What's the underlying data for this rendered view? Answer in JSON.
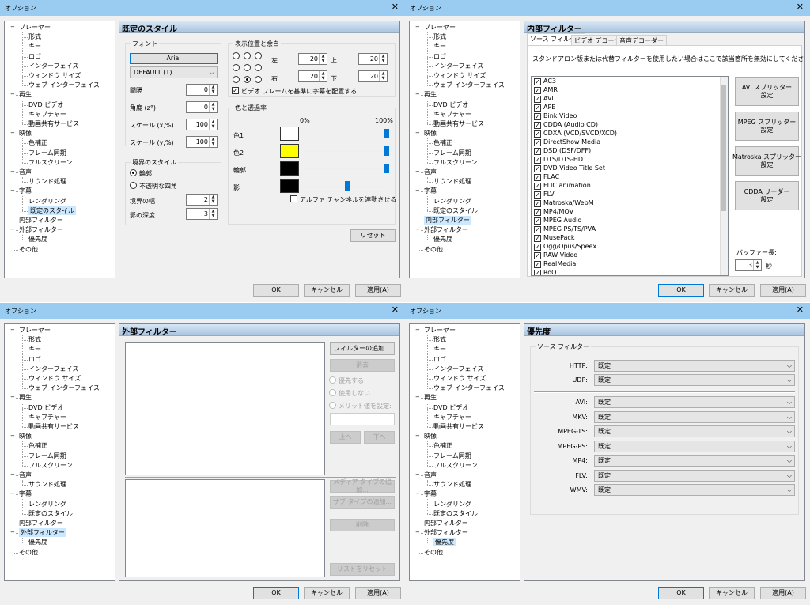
{
  "title": "オプション",
  "close": "✕",
  "tree": [
    {
      "label": "プレーヤー",
      "lv": 0,
      "tog": "−"
    },
    {
      "label": "形式",
      "lv": 1
    },
    {
      "label": "キー",
      "lv": 1
    },
    {
      "label": "ロゴ",
      "lv": 1
    },
    {
      "label": "インターフェイス",
      "lv": 1
    },
    {
      "label": "ウィンドウ サイズ",
      "lv": 1
    },
    {
      "label": "ウェブ インターフェイス",
      "lv": 1
    },
    {
      "label": "再生",
      "lv": 0,
      "tog": "−"
    },
    {
      "label": "DVD ビデオ",
      "lv": 1
    },
    {
      "label": "キャプチャー",
      "lv": 1
    },
    {
      "label": "動画共有サービス",
      "lv": 1
    },
    {
      "label": "映像",
      "lv": 0,
      "tog": "−"
    },
    {
      "label": "色補正",
      "lv": 1
    },
    {
      "label": "フレーム同期",
      "lv": 1
    },
    {
      "label": "フルスクリーン",
      "lv": 1
    },
    {
      "label": "音声",
      "lv": 0,
      "tog": "−"
    },
    {
      "label": "サウンド処理",
      "lv": 1
    },
    {
      "label": "字幕",
      "lv": 0,
      "tog": "−"
    },
    {
      "label": "レンダリング",
      "lv": 1
    },
    {
      "label": "既定のスタイル",
      "lv": 1
    },
    {
      "label": "内部フィルター",
      "lv": 0
    },
    {
      "label": "外部フィルター",
      "lv": 0,
      "tog": "−"
    },
    {
      "label": "優先度",
      "lv": 1
    },
    {
      "label": "その他",
      "lv": 0
    }
  ],
  "footer": {
    "ok": "OK",
    "cancel": "キャンセル",
    "apply": "適用(A)"
  },
  "w1": {
    "head": "既定のスタイル",
    "font_group": "フォント",
    "font_btn": "Arial",
    "charset": "DEFAULT (1)",
    "spacing_lbl": "間隔",
    "spacing": "0",
    "angle_lbl": "角度 (z°)",
    "angle": "0",
    "scalex_lbl": "スケール (x,%)",
    "scalex": "100",
    "scaley_lbl": "スケール (y,%)",
    "scaley": "100",
    "border_group": "境界のスタイル",
    "outline": "輪郭",
    "opaque": "不透明な四角",
    "bw_lbl": "境界の幅",
    "bw": "2",
    "sd_lbl": "影の深度",
    "sd": "3",
    "pos_group": "表示位置と余白",
    "left_lbl": "左",
    "left": "20",
    "top_lbl": "上",
    "top": "20",
    "right_lbl": "右",
    "right": "20",
    "bottom_lbl": "下",
    "bottom": "20",
    "video_frame": "ビデオ フレームを基準に字幕を配置する",
    "color_group": "色と透過率",
    "pct0": "0%",
    "pct100": "100%",
    "c1": "色1",
    "c2": "色2",
    "co": "輪郭",
    "cs": "影",
    "c1_color": "#ffffff",
    "c2_color": "#ffff00",
    "co_color": "#000000",
    "cs_color": "#000000",
    "link_alpha": "アルファ チャンネルを連動させる",
    "reset": "リセット"
  },
  "w2": {
    "head": "内部フィルター",
    "tabs": [
      "ソース フィルター",
      "ビデオ デコーダー",
      "音声デコーダー"
    ],
    "desc": "スタンドアロン版または代替フィルターを使用したい場合はここで該当箇所を無効にしてください。",
    "filters": [
      "AC3",
      "AMR",
      "AVI",
      "APE",
      "Bink Video",
      "CDDA (Audio CD)",
      "CDXA (VCD/SVCD/XCD)",
      "DirectShow Media",
      "DSD (DSF/DFF)",
      "DTS/DTS-HD",
      "DVD Video Title Set",
      "FLAC",
      "FLIC animation",
      "FLV",
      "Matroska/WebM",
      "MP4/MOV",
      "MPEG Audio",
      "MPEG PS/TS/PVA",
      "MusePack",
      "Ogg/Opus/Speex",
      "RAW Video",
      "RealMedia",
      "RoQ"
    ],
    "btn_avi": "AVI スプリッター\n設定",
    "btn_mpeg": "MPEG スプリッター\n設定",
    "btn_mkv": "Matroska スプリッター\n設定",
    "btn_cdda": "CDDA リーダー\n設定",
    "buffer_lbl": "バッファー長:",
    "buffer": "3",
    "buffer_unit": "秒"
  },
  "w3": {
    "head": "外部フィルター",
    "add_filter": "フィルターの追加...",
    "remove": "消去",
    "prefer": "優先する",
    "block": "使用しない",
    "merit": "メリット値を設定:",
    "up": "上へ",
    "down": "下へ",
    "add_media": "メディア タイプの追加...",
    "add_sub": "サブ タイプの追加...",
    "del": "削除",
    "reset_list": "リストをリセット"
  },
  "w4": {
    "head": "優先度",
    "group": "ソース フィルター",
    "rows": [
      {
        "label": "HTTP:",
        "value": "既定"
      },
      {
        "label": "UDP:",
        "value": "既定"
      },
      {
        "label": "AVI:",
        "value": "既定"
      },
      {
        "label": "MKV:",
        "value": "既定"
      },
      {
        "label": "MPEG-TS:",
        "value": "既定"
      },
      {
        "label": "MPEG-PS:",
        "value": "既定"
      },
      {
        "label": "MP4:",
        "value": "既定"
      },
      {
        "label": "FLV:",
        "value": "既定"
      },
      {
        "label": "WMV:",
        "value": "既定"
      }
    ]
  }
}
